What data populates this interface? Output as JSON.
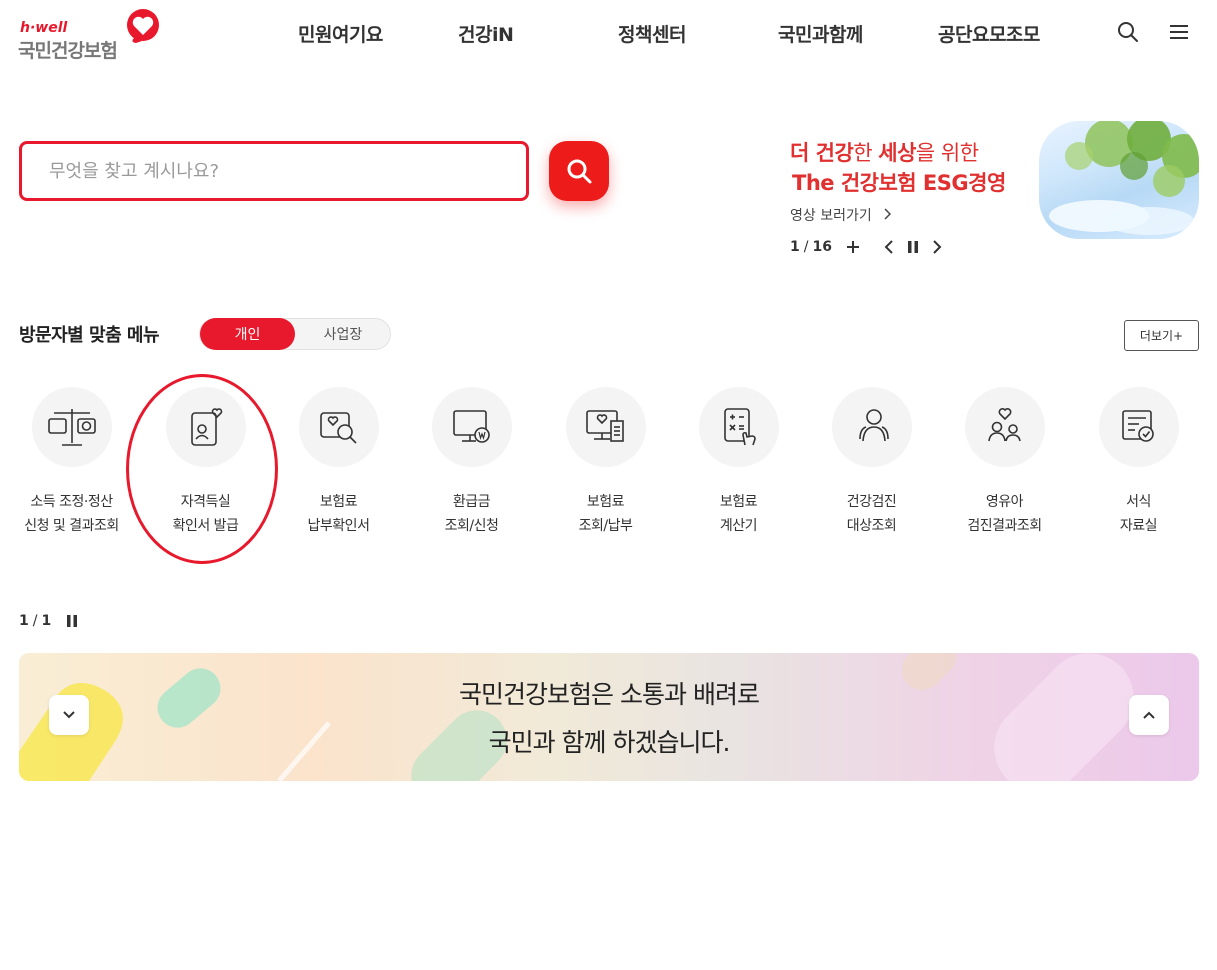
{
  "logo": {
    "tagline": "h·well",
    "name": "국민건강보험"
  },
  "nav": [
    "민원여기요",
    "건강iN",
    "정책센터",
    "국민과함께",
    "공단요모조모"
  ],
  "search": {
    "placeholder": "무엇을 찾고 계시나요?"
  },
  "banner": {
    "line1_red": "더 건강",
    "line1_mid": "한 ",
    "line1_red2": "세상",
    "line1_end": "을 위한",
    "line2": "The 건강보험 ESG경영",
    "link": "영상 보러가기",
    "counter_current": "1",
    "counter_total": "16"
  },
  "visitor_menu": {
    "title": "방문자별 맞춤 메뉴",
    "tab_active": "개인",
    "tab_inactive": "사업장",
    "more": "더보기+",
    "items": [
      {
        "line1": "소득 조정·정산",
        "line2": "신청 및 결과조회",
        "icon": "scale-icon"
      },
      {
        "line1": "자격득실",
        "line2": "확인서 발급",
        "icon": "id-card-heart-icon"
      },
      {
        "line1": "보험료",
        "line2": "납부확인서",
        "icon": "search-heart-icon"
      },
      {
        "line1": "환급금",
        "line2": "조회/신청",
        "icon": "monitor-won-icon"
      },
      {
        "line1": "보험료",
        "line2": "조회/납부",
        "icon": "monitor-receipt-icon"
      },
      {
        "line1": "보험료",
        "line2": "계산기",
        "icon": "calculator-icon"
      },
      {
        "line1": "건강검진",
        "line2": "대상조회",
        "icon": "people-icon"
      },
      {
        "line1": "영유아",
        "line2": "검진결과조회",
        "icon": "family-heart-icon"
      },
      {
        "line1": "서식",
        "line2": "자료실",
        "icon": "document-check-icon"
      }
    ],
    "pager_current": "1",
    "pager_total": "1"
  },
  "message_banner": {
    "line1": "국민건강보험은 소통과 배려로",
    "line2": "국민과 함께 하겠습니다."
  },
  "colors": {
    "brand_red": "#e8192c",
    "banner_red": "#e03130"
  }
}
